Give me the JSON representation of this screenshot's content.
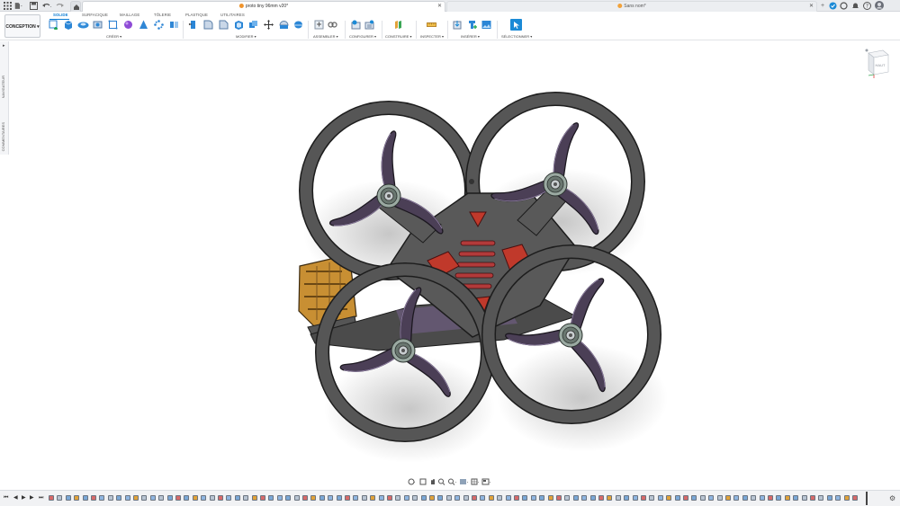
{
  "window": {
    "active_tab_title": "proto tiny 96mm v20*",
    "second_tab_title": "Sans nom*"
  },
  "workspace": {
    "label": "CONCEPTION",
    "arrow": "▾"
  },
  "ribbon": {
    "tabs": [
      "SOLIDE",
      "SURFACIQUE",
      "MAILLAGE",
      "TÔLERIE",
      "PLASTIQUE",
      "UTILITAIRES"
    ],
    "active_tab": "SOLIDE",
    "groups": [
      {
        "label": "CRÉER ▾"
      },
      {
        "label": "MODIFIER ▾"
      },
      {
        "label": "ASSEMBLER ▾"
      },
      {
        "label": "CONFIGURER ▾"
      },
      {
        "label": "CONSTRUIRE ▾"
      },
      {
        "label": "INSPECTER ▾"
      },
      {
        "label": "INSÉRER ▾"
      },
      {
        "label": "SÉLECTIONNER ▾"
      }
    ]
  },
  "left_panels": {
    "navigator": "NAVIGATEUR",
    "comments": "COMMENTAIRES"
  },
  "viewcube": {
    "face": "HAUT"
  },
  "colors": {
    "accent": "#0a7bd3",
    "frame": "#5b5b5b",
    "propeller": "#4a3c52",
    "red_parts": "#c0392b",
    "orange_parts": "#b8862f"
  }
}
